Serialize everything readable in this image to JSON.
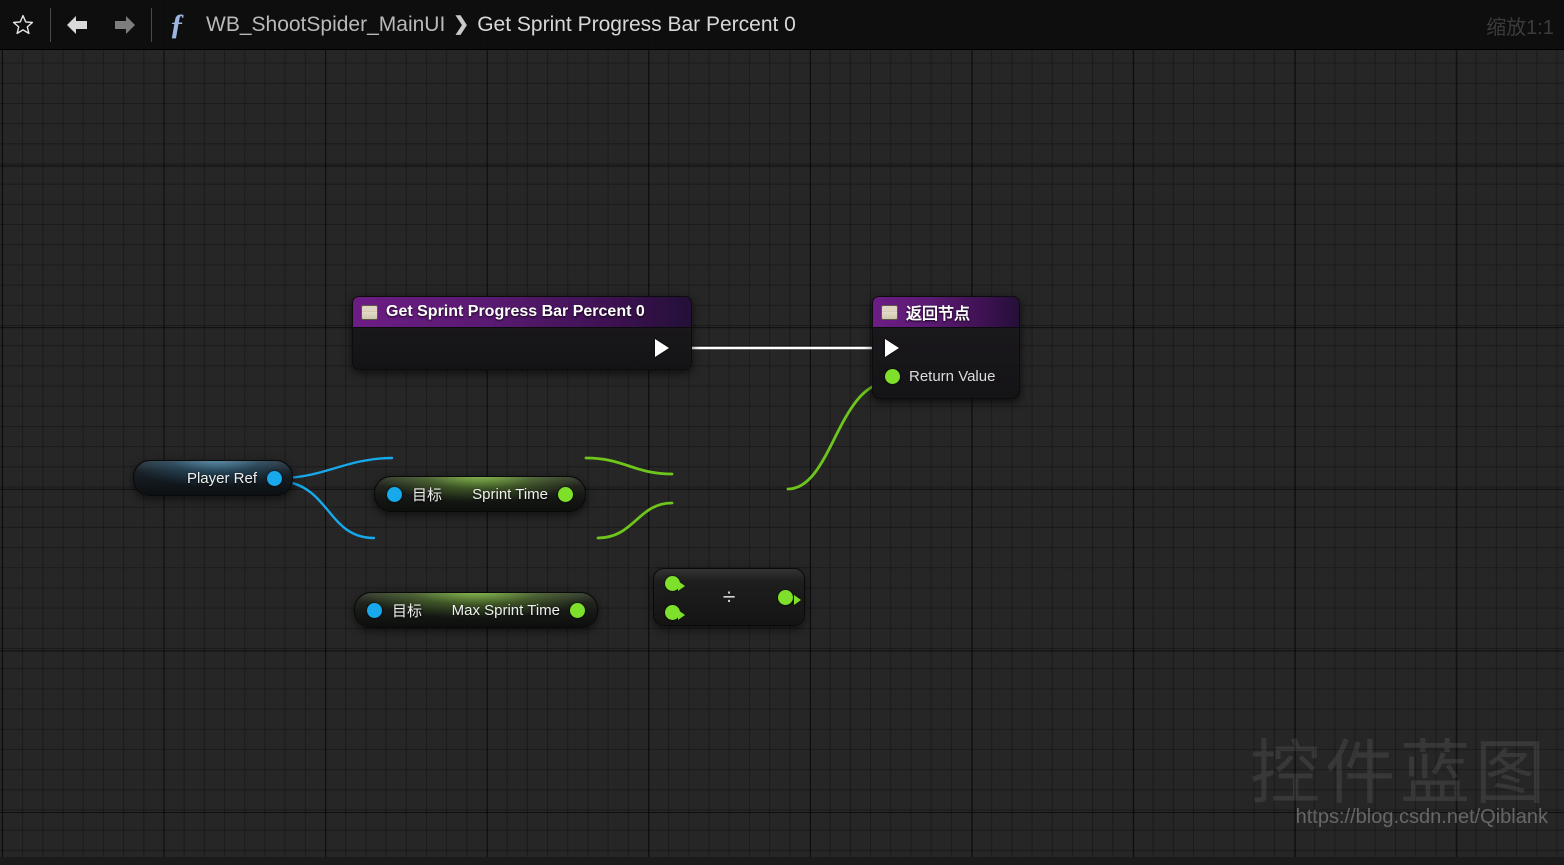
{
  "window": {
    "zoom_label": "缩放1:1"
  },
  "toolbar": {
    "favorite_icon": "star-outline-icon",
    "back_icon": "arrow-left-icon",
    "forward_icon": "arrow-right-icon",
    "function_icon": "function-f-icon"
  },
  "breadcrumb": {
    "root": "WB_ShootSpider_MainUI",
    "separator": "❯",
    "current": "Get Sprint Progress Bar Percent 0"
  },
  "graph": {
    "nodes": [
      {
        "id": "entry",
        "type": "function-entry",
        "title": "Get Sprint Progress Bar Percent 0",
        "glyph": "function-node-icon",
        "output_exec": "exec-out-pin"
      },
      {
        "id": "result",
        "type": "function-result",
        "title": "返回节点",
        "glyph": "function-node-icon",
        "input_exec": "exec-in-pin",
        "pins": [
          {
            "label": "Return Value",
            "color": "#7ee02a"
          }
        ]
      },
      {
        "id": "player-ref",
        "type": "variable-get",
        "label": "Player Ref",
        "pin_color": "#17a9ec"
      },
      {
        "id": "sprint-time",
        "type": "variable-get",
        "target_label": "目标",
        "label": "Sprint Time",
        "in_pin_color": "#17a9ec",
        "out_pin_color": "#7ee02a"
      },
      {
        "id": "max-sprint-time",
        "type": "variable-get",
        "target_label": "目标",
        "label": "Max Sprint Time",
        "in_pin_color": "#17a9ec",
        "out_pin_color": "#7ee02a"
      },
      {
        "id": "divide",
        "type": "math-divide",
        "operator": "÷",
        "inputs": 2,
        "outputs": 1,
        "pin_color": "#7ee02a"
      }
    ],
    "wires": [
      {
        "from": "entry.exec-out",
        "to": "result.exec-in",
        "color": "#ffffff",
        "kind": "exec"
      },
      {
        "from": "player-ref.out",
        "to": "sprint-time.target",
        "color": "#17a9ec",
        "kind": "data"
      },
      {
        "from": "player-ref.out",
        "to": "max-sprint-time.target",
        "color": "#17a9ec",
        "kind": "data"
      },
      {
        "from": "sprint-time.out",
        "to": "divide.in-a",
        "color": "#7ee02a",
        "kind": "data"
      },
      {
        "from": "max-sprint-time.out",
        "to": "divide.in-b",
        "color": "#7ee02a",
        "kind": "data"
      },
      {
        "from": "divide.out",
        "to": "result.return-value",
        "color": "#7ee02a",
        "kind": "data"
      }
    ]
  },
  "watermark": {
    "text": "控件蓝图",
    "url": "https://blog.csdn.net/Qiblank"
  }
}
